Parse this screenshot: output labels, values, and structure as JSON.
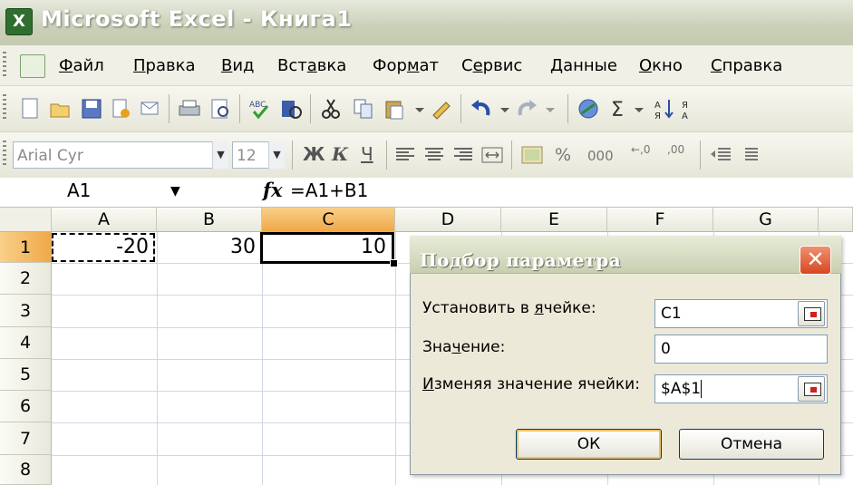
{
  "window": {
    "title": "Microsoft Excel - Книга1",
    "app_icon": "excel-icon"
  },
  "menu": {
    "items": [
      {
        "u": "Ф",
        "rest": "айл"
      },
      {
        "u": "П",
        "rest": "равка"
      },
      {
        "u": "В",
        "rest": "ид"
      },
      {
        "pre": "Вст",
        "u": "а",
        "rest": "вка"
      },
      {
        "pre": "Фор",
        "u": "м",
        "rest": "ат"
      },
      {
        "pre": "С",
        "u": "е",
        "rest": "рвис"
      },
      {
        "u": "Д",
        "rest": "анные"
      },
      {
        "u": "О",
        "rest": "кно"
      },
      {
        "u": "С",
        "rest": "правка"
      }
    ]
  },
  "format_toolbar": {
    "font": "Arial Cyr",
    "size": "12",
    "bold": "Ж",
    "italic": "К",
    "underline": "Ч",
    "percent": "%",
    "thousands": "000",
    "inc_decimals": "←,0",
    "dec_decimals": ",00"
  },
  "formula_bar": {
    "name_box": "A1",
    "fx": "fx",
    "formula": "=A1+B1"
  },
  "sheet": {
    "columns": [
      "A",
      "B",
      "C",
      "D",
      "E",
      "F",
      "G"
    ],
    "selected_column": "C",
    "rows": [
      "1",
      "2",
      "3",
      "4",
      "5",
      "6",
      "7",
      "8"
    ],
    "cells": {
      "A1": "-20",
      "B1": "30",
      "C1": "10"
    }
  },
  "dialog": {
    "title": "Подбор параметра",
    "set_cell_label": {
      "pre": "Установить в ",
      "u": "я",
      "rest": "чейке:"
    },
    "set_cell_value": "C1",
    "value_label": {
      "pre": "Зна",
      "u": "ч",
      "rest": "ение:"
    },
    "value_value": "0",
    "changing_label": {
      "pre": "",
      "u": "И",
      "rest": "зменяя значение ячейки:"
    },
    "changing_value": "$A$1",
    "ok": "ОК",
    "cancel": "Отмена"
  }
}
